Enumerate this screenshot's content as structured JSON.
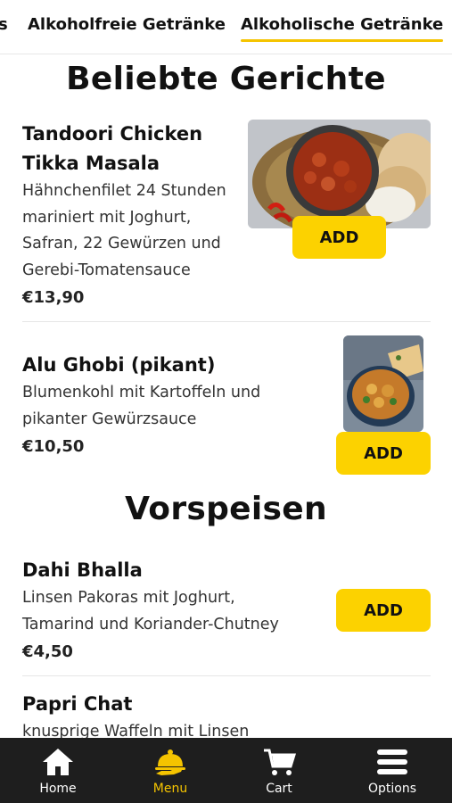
{
  "tabs": [
    {
      "label": "s"
    },
    {
      "label": "Alkoholfreie Getränke"
    },
    {
      "label": "Alkoholische Getränke",
      "active": true
    }
  ],
  "sections": [
    {
      "title": "Beliebte Gerichte",
      "items": [
        {
          "name_lines": [
            "Tandoori Chicken",
            "Tikka Masala"
          ],
          "desc_lines": [
            "Hähnchenfilet 24 Stunden",
            "mariniert mit Joghurt,",
            "Safran, 22 Gewürzen und",
            "Gerebi-Tomatensauce"
          ],
          "price": "€13,90",
          "add_label": "ADD"
        },
        {
          "name_lines": [
            "Alu Ghobi (pikant)"
          ],
          "desc_lines": [
            "Blumenkohl mit Kartoffeln und",
            "pikanter Gewürzsauce"
          ],
          "price": "€10,50",
          "add_label": "ADD"
        }
      ]
    },
    {
      "title": "Vorspeisen",
      "items": [
        {
          "name_lines": [
            "Dahi Bhalla"
          ],
          "desc_lines": [
            "Linsen Pakoras mit Joghurt,",
            "Tamarind und Koriander-Chutney"
          ],
          "price": "€4,50",
          "add_label": "ADD"
        },
        {
          "name_lines": [
            "Papri Chat"
          ],
          "desc_lines": [
            "knusprige Waffeln mit Linsen"
          ]
        }
      ]
    }
  ],
  "bottom_nav": [
    {
      "label": "Home",
      "icon": "home-icon"
    },
    {
      "label": "Menu",
      "icon": "menu-cloche-icon",
      "active": true
    },
    {
      "label": "Cart",
      "icon": "cart-icon"
    },
    {
      "label": "Options",
      "icon": "hamburger-icon"
    }
  ],
  "colors": {
    "accent": "#fcd200",
    "nav_bg": "#1e1e1e",
    "nav_active": "#f5c400"
  }
}
